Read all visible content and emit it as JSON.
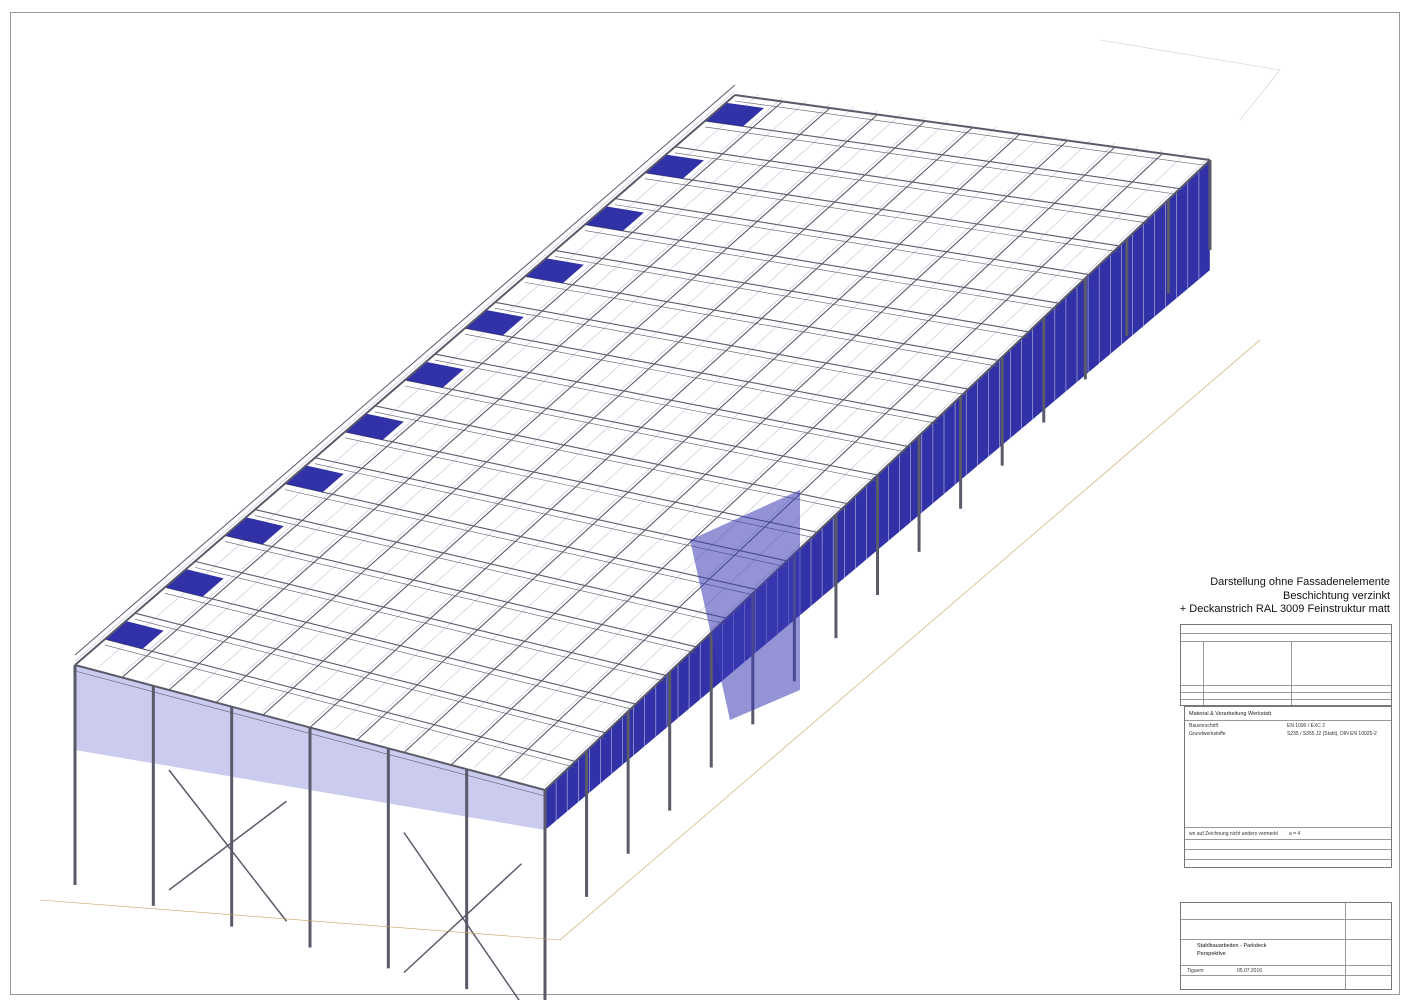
{
  "notes": {
    "line1": "Darstellung ohne Fassadenelemente",
    "line2": "Beschichtung verzinkt",
    "line3": "+ Deckanstrich RAL 3009 Feinstruktur matt"
  },
  "material_block": {
    "heading": "Material & Verarbeitung Werkstatt",
    "rows": [
      {
        "label": "Bauvorschrift",
        "value": "EN 1090 / EXC 2"
      },
      {
        "label": "Grundwerkstoffe",
        "value": "S235 / S355 J2 (Stahl), DIN EN 10025-2"
      }
    ],
    "note_line": "wo auf Zeichnung nicht anders vermerkt",
    "note_value": "a = 4"
  },
  "title_block": {
    "project": "Stahlbauarbeiten - Parkdeck",
    "view": "Perspektive",
    "drawn": "Tiguem",
    "date": "05.07.2016"
  },
  "colors": {
    "member_blue": "#1c1c9e",
    "member_gray": "#5a5a6a",
    "frame_gray": "#9a9a9a"
  }
}
